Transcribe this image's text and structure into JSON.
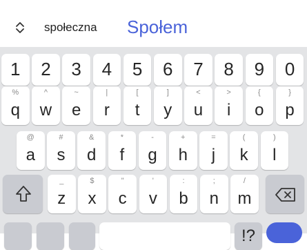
{
  "suggestions": {
    "expand_icon": "expand-collapse-icon",
    "words": [
      "społeczna",
      "Społem"
    ]
  },
  "keyboard": {
    "numbers": [
      "1",
      "2",
      "3",
      "4",
      "5",
      "6",
      "7",
      "8",
      "9",
      "0"
    ],
    "row1": [
      {
        "key": "q",
        "hint": "%"
      },
      {
        "key": "w",
        "hint": "^"
      },
      {
        "key": "e",
        "hint": "~"
      },
      {
        "key": "r",
        "hint": "|"
      },
      {
        "key": "t",
        "hint": "["
      },
      {
        "key": "y",
        "hint": "]"
      },
      {
        "key": "u",
        "hint": "<"
      },
      {
        "key": "i",
        "hint": ">"
      },
      {
        "key": "o",
        "hint": "{"
      },
      {
        "key": "p",
        "hint": "}"
      }
    ],
    "row2": [
      {
        "key": "a",
        "hint": "@"
      },
      {
        "key": "s",
        "hint": "#"
      },
      {
        "key": "d",
        "hint": "&"
      },
      {
        "key": "f",
        "hint": "*"
      },
      {
        "key": "g",
        "hint": "-"
      },
      {
        "key": "h",
        "hint": "+"
      },
      {
        "key": "j",
        "hint": "="
      },
      {
        "key": "k",
        "hint": "("
      },
      {
        "key": "l",
        "hint": ")"
      }
    ],
    "row3": [
      {
        "key": "z",
        "hint": "_"
      },
      {
        "key": "x",
        "hint": "$"
      },
      {
        "key": "c",
        "hint": "\""
      },
      {
        "key": "v",
        "hint": "'"
      },
      {
        "key": "b",
        "hint": ":"
      },
      {
        "key": "n",
        "hint": ";"
      },
      {
        "key": "m",
        "hint": "/"
      }
    ],
    "shift_icon": "shift-icon",
    "backspace_icon": "backspace-icon",
    "partial_bottom_label": "!?",
    "colors": {
      "background": "#e3e4e6",
      "key": "#ffffff",
      "modifier_key": "#c9cbd1",
      "accent": "#4a63d9"
    }
  }
}
